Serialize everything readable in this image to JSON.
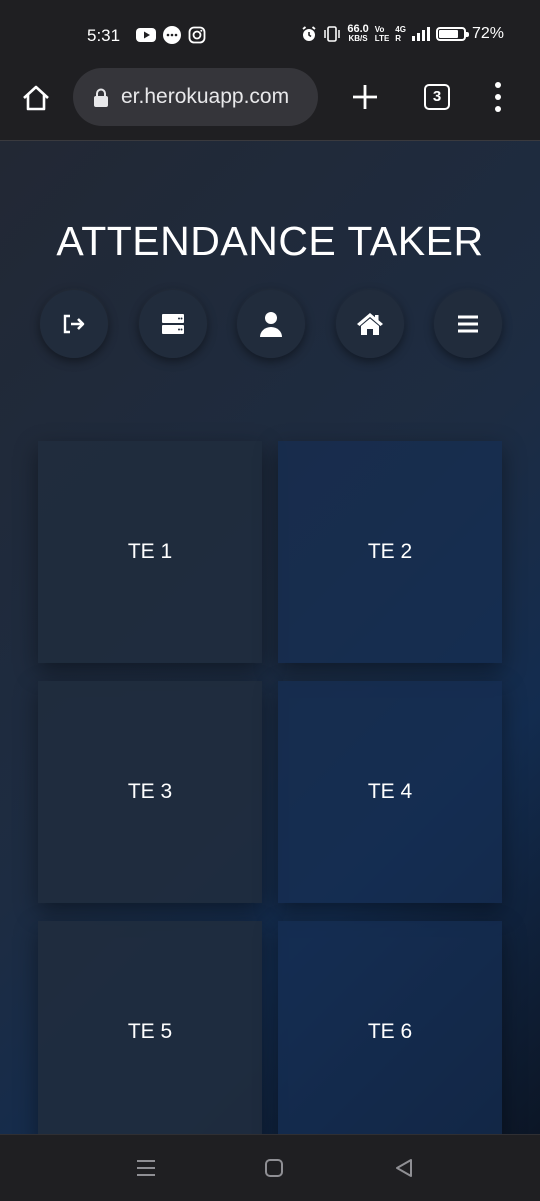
{
  "status_bar": {
    "time": "5:31",
    "speed_value": "66.0",
    "speed_unit": "KB/S",
    "volte_top": "Vo",
    "volte_bottom": "LTE",
    "network": "4G",
    "battery_pct": "72%",
    "battery_level": 0.72
  },
  "browser": {
    "url": "er.herokuapp.com",
    "tab_count": "3"
  },
  "app": {
    "title": "ATTENDANCE TAKER",
    "nav_icons": [
      "logout-icon",
      "server-icon",
      "user-icon",
      "home-icon",
      "menu-icon"
    ],
    "cards": [
      "TE 1",
      "TE 2",
      "TE 3",
      "TE 4",
      "TE 5",
      "TE 6"
    ]
  },
  "colors": {
    "background_dark": "#1c1c1f",
    "page_gradient_start": "#222834",
    "page_gradient_end": "#132c4f",
    "text": "#ffffff"
  }
}
